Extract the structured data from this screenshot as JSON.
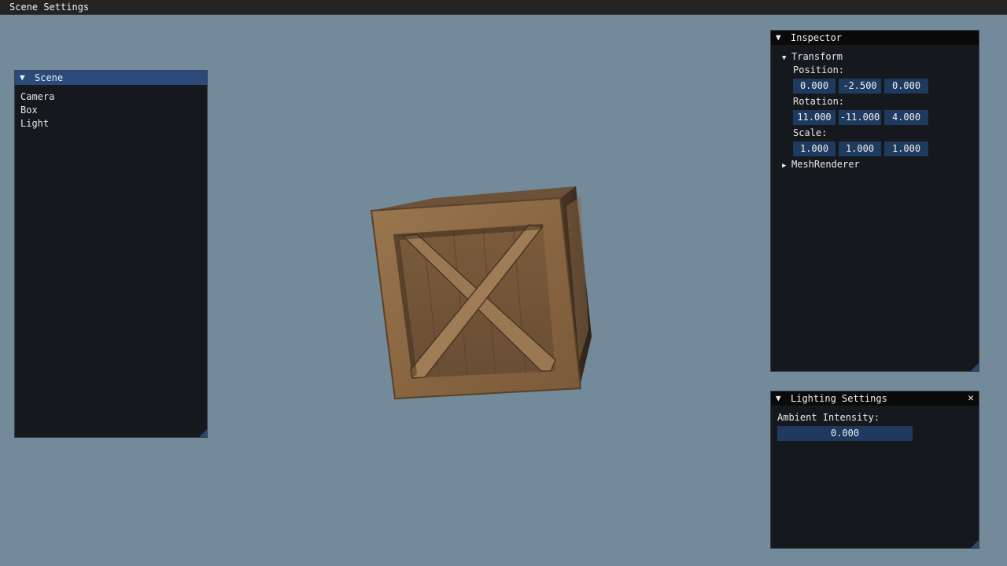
{
  "menubar": {
    "title": "Scene Settings"
  },
  "scene": {
    "title": "Scene",
    "items": [
      "Camera",
      "Box",
      "Light"
    ]
  },
  "inspector": {
    "title": "Inspector",
    "transform": {
      "label": "Transform",
      "position_label": "Position:",
      "position": [
        "0.000",
        "-2.500",
        "0.000"
      ],
      "rotation_label": "Rotation:",
      "rotation": [
        "11.000",
        "-11.000",
        "4.000"
      ],
      "scale_label": "Scale:",
      "scale": [
        "1.000",
        "1.000",
        "1.000"
      ]
    },
    "mesh_renderer": {
      "label": "MeshRenderer"
    }
  },
  "lighting": {
    "title": "Lighting Settings",
    "ambient_label": "Ambient Intensity:",
    "ambient_value": "0.000"
  },
  "colors": {
    "background": "#728a99",
    "panel": "#15181c",
    "active_title": "#294a7a",
    "field": "#1f3a5f"
  },
  "icons": {
    "collapse": "triangle-down-icon",
    "expand": "triangle-right-icon",
    "close": "close-icon"
  }
}
